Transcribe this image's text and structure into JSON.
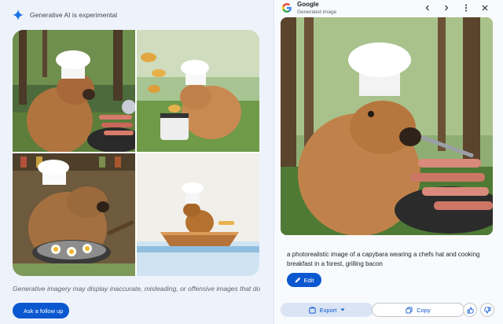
{
  "left": {
    "experimental_text": "Generative AI is experimental",
    "disclaimer": "Generative imagery may display inaccurate, misleading, or offensive images that do",
    "follow_up_label": "Ask a follow up"
  },
  "images": [
    {
      "icon": "capybara-chef-grilling-bacon-photo"
    },
    {
      "icon": "capybara-chef-cooking-pancakes-painting"
    },
    {
      "icon": "capybara-chef-frying-eggs-painting"
    },
    {
      "icon": "capybara-chef-rowing-boat-watercolor"
    }
  ],
  "viewer": {
    "source_name": "Google",
    "source_subtitle": "Generated image",
    "prompt": "a photorealistic image of a capybara wearing a chefs hat and cooking breakfast in a forest, grilling bacon",
    "edit_label": "Edit",
    "export_label": "Export",
    "copy_label": "Copy"
  },
  "colors": {
    "accent": "#0b57d0",
    "page_bg": "#eef3fb",
    "panel_bg": "#f8fafd"
  }
}
